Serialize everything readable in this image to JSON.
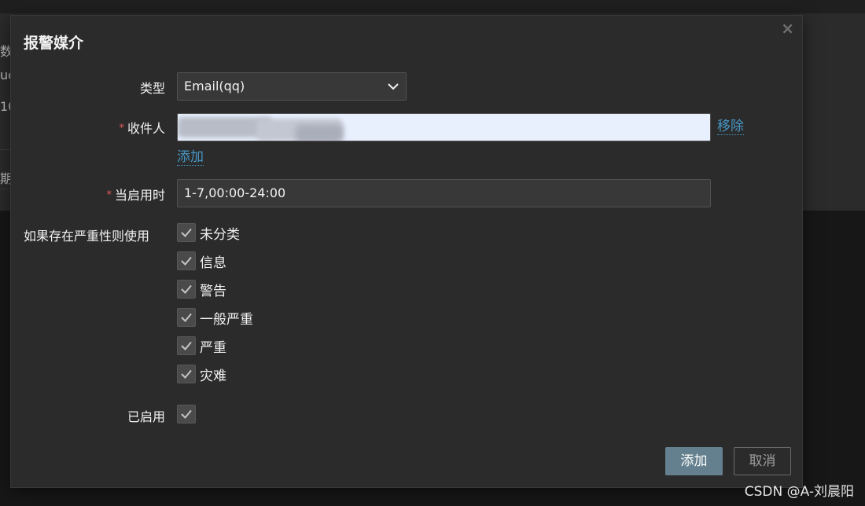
{
  "background": {
    "fragments": [
      "数",
      "uc",
      "10",
      "期"
    ]
  },
  "dialog": {
    "title": "报警媒介",
    "close_label": "×",
    "type": {
      "label": "类型",
      "value": "Email(qq)"
    },
    "recipient": {
      "required_mark": "*",
      "label": "收件人",
      "value": "",
      "remove_label": "移除",
      "add_label": "添加"
    },
    "when_active": {
      "required_mark": "*",
      "label": "当启用时",
      "value": "1-7,00:00-24:00"
    },
    "severity": {
      "label": "如果存在严重性则使用",
      "options": [
        {
          "label": "未分类",
          "checked": true
        },
        {
          "label": "信息",
          "checked": true
        },
        {
          "label": "警告",
          "checked": true
        },
        {
          "label": "一般严重",
          "checked": true
        },
        {
          "label": "严重",
          "checked": true
        },
        {
          "label": "灾难",
          "checked": true
        }
      ]
    },
    "enabled": {
      "label": "已启用",
      "checked": true
    },
    "buttons": {
      "add": "添加",
      "cancel": "取消"
    }
  },
  "watermark": "CSDN @A-刘晨阳",
  "colors": {
    "accent": "#4796c4",
    "primary_button": "#64808e",
    "required": "#e45959",
    "modal_bg": "#2b2b2b"
  }
}
